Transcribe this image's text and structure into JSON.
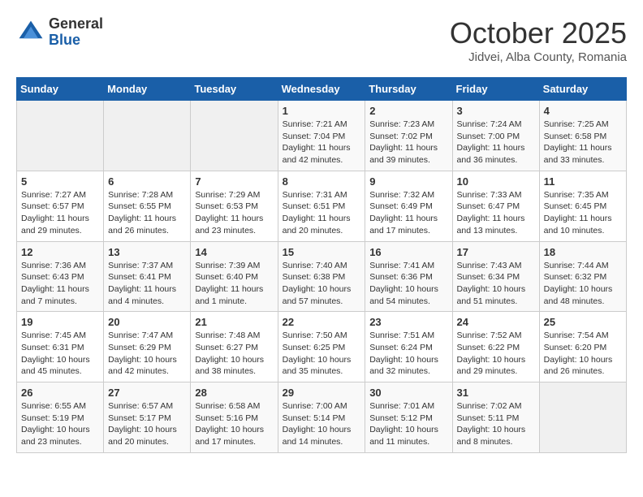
{
  "header": {
    "logo_general": "General",
    "logo_blue": "Blue",
    "month": "October 2025",
    "location": "Jidvei, Alba County, Romania"
  },
  "days_of_week": [
    "Sunday",
    "Monday",
    "Tuesday",
    "Wednesday",
    "Thursday",
    "Friday",
    "Saturday"
  ],
  "weeks": [
    [
      {
        "day": "",
        "info": ""
      },
      {
        "day": "",
        "info": ""
      },
      {
        "day": "",
        "info": ""
      },
      {
        "day": "1",
        "info": "Sunrise: 7:21 AM\nSunset: 7:04 PM\nDaylight: 11 hours\nand 42 minutes."
      },
      {
        "day": "2",
        "info": "Sunrise: 7:23 AM\nSunset: 7:02 PM\nDaylight: 11 hours\nand 39 minutes."
      },
      {
        "day": "3",
        "info": "Sunrise: 7:24 AM\nSunset: 7:00 PM\nDaylight: 11 hours\nand 36 minutes."
      },
      {
        "day": "4",
        "info": "Sunrise: 7:25 AM\nSunset: 6:58 PM\nDaylight: 11 hours\nand 33 minutes."
      }
    ],
    [
      {
        "day": "5",
        "info": "Sunrise: 7:27 AM\nSunset: 6:57 PM\nDaylight: 11 hours\nand 29 minutes."
      },
      {
        "day": "6",
        "info": "Sunrise: 7:28 AM\nSunset: 6:55 PM\nDaylight: 11 hours\nand 26 minutes."
      },
      {
        "day": "7",
        "info": "Sunrise: 7:29 AM\nSunset: 6:53 PM\nDaylight: 11 hours\nand 23 minutes."
      },
      {
        "day": "8",
        "info": "Sunrise: 7:31 AM\nSunset: 6:51 PM\nDaylight: 11 hours\nand 20 minutes."
      },
      {
        "day": "9",
        "info": "Sunrise: 7:32 AM\nSunset: 6:49 PM\nDaylight: 11 hours\nand 17 minutes."
      },
      {
        "day": "10",
        "info": "Sunrise: 7:33 AM\nSunset: 6:47 PM\nDaylight: 11 hours\nand 13 minutes."
      },
      {
        "day": "11",
        "info": "Sunrise: 7:35 AM\nSunset: 6:45 PM\nDaylight: 11 hours\nand 10 minutes."
      }
    ],
    [
      {
        "day": "12",
        "info": "Sunrise: 7:36 AM\nSunset: 6:43 PM\nDaylight: 11 hours\nand 7 minutes."
      },
      {
        "day": "13",
        "info": "Sunrise: 7:37 AM\nSunset: 6:41 PM\nDaylight: 11 hours\nand 4 minutes."
      },
      {
        "day": "14",
        "info": "Sunrise: 7:39 AM\nSunset: 6:40 PM\nDaylight: 11 hours\nand 1 minute."
      },
      {
        "day": "15",
        "info": "Sunrise: 7:40 AM\nSunset: 6:38 PM\nDaylight: 10 hours\nand 57 minutes."
      },
      {
        "day": "16",
        "info": "Sunrise: 7:41 AM\nSunset: 6:36 PM\nDaylight: 10 hours\nand 54 minutes."
      },
      {
        "day": "17",
        "info": "Sunrise: 7:43 AM\nSunset: 6:34 PM\nDaylight: 10 hours\nand 51 minutes."
      },
      {
        "day": "18",
        "info": "Sunrise: 7:44 AM\nSunset: 6:32 PM\nDaylight: 10 hours\nand 48 minutes."
      }
    ],
    [
      {
        "day": "19",
        "info": "Sunrise: 7:45 AM\nSunset: 6:31 PM\nDaylight: 10 hours\nand 45 minutes."
      },
      {
        "day": "20",
        "info": "Sunrise: 7:47 AM\nSunset: 6:29 PM\nDaylight: 10 hours\nand 42 minutes."
      },
      {
        "day": "21",
        "info": "Sunrise: 7:48 AM\nSunset: 6:27 PM\nDaylight: 10 hours\nand 38 minutes."
      },
      {
        "day": "22",
        "info": "Sunrise: 7:50 AM\nSunset: 6:25 PM\nDaylight: 10 hours\nand 35 minutes."
      },
      {
        "day": "23",
        "info": "Sunrise: 7:51 AM\nSunset: 6:24 PM\nDaylight: 10 hours\nand 32 minutes."
      },
      {
        "day": "24",
        "info": "Sunrise: 7:52 AM\nSunset: 6:22 PM\nDaylight: 10 hours\nand 29 minutes."
      },
      {
        "day": "25",
        "info": "Sunrise: 7:54 AM\nSunset: 6:20 PM\nDaylight: 10 hours\nand 26 minutes."
      }
    ],
    [
      {
        "day": "26",
        "info": "Sunrise: 6:55 AM\nSunset: 5:19 PM\nDaylight: 10 hours\nand 23 minutes."
      },
      {
        "day": "27",
        "info": "Sunrise: 6:57 AM\nSunset: 5:17 PM\nDaylight: 10 hours\nand 20 minutes."
      },
      {
        "day": "28",
        "info": "Sunrise: 6:58 AM\nSunset: 5:16 PM\nDaylight: 10 hours\nand 17 minutes."
      },
      {
        "day": "29",
        "info": "Sunrise: 7:00 AM\nSunset: 5:14 PM\nDaylight: 10 hours\nand 14 minutes."
      },
      {
        "day": "30",
        "info": "Sunrise: 7:01 AM\nSunset: 5:12 PM\nDaylight: 10 hours\nand 11 minutes."
      },
      {
        "day": "31",
        "info": "Sunrise: 7:02 AM\nSunset: 5:11 PM\nDaylight: 10 hours\nand 8 minutes."
      },
      {
        "day": "",
        "info": ""
      }
    ]
  ]
}
